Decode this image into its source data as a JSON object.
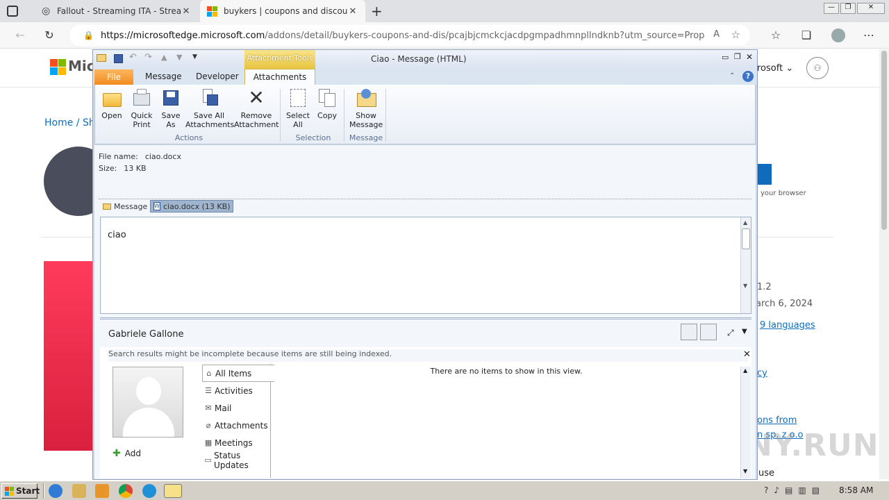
{
  "browser": {
    "tabs": [
      {
        "title": "Fallout - Streaming ITA - Streami",
        "active": false
      },
      {
        "title": "buykers | coupons and discount",
        "active": true
      }
    ],
    "url_domain": "https://microsoftedge.microsoft.com",
    "url_path": "/addons/detail/buykers-coupons-and-dis/pcajbjcmckcjacdpgmpadhmnpllndknb?utm_source=Propeller..."
  },
  "webpage": {
    "brand": "Mic",
    "microsoft_menu": "rosoft",
    "breadcrumb_home": "Home",
    "breadcrumb_sep": " / Sh",
    "browser_note": "your browser",
    "version_frag": "1.2",
    "date_frag": "arch 6, 2024",
    "languages_link": "9 languages",
    "privacy_frag": "cy",
    "options_frag": "ons from",
    "company_frag": "n sp. z o.o",
    "use_frag": "use",
    "watermark": "ANY.RUN"
  },
  "outlook": {
    "title": "Ciao  -  Message (HTML)",
    "contextual_tab": "Attachment Tools",
    "tabs": [
      "File",
      "Message",
      "Developer",
      "Attachments"
    ],
    "ribbon": {
      "open": "Open",
      "quick_print_1": "Quick",
      "quick_print_2": "Print",
      "save_as_1": "Save",
      "save_as_2": "As",
      "save_all_1": "Save All",
      "save_all_2": "Attachments",
      "remove_1": "Remove",
      "remove_2": "Attachment",
      "select_all_1": "Select",
      "select_all_2": "All",
      "copy": "Copy",
      "show_msg_1": "Show",
      "show_msg_2": "Message",
      "groups": [
        "Actions",
        "Selection",
        "Message"
      ]
    },
    "file_name_label": "File name:",
    "file_name_value": "ciao.docx",
    "size_label": "Size:",
    "size_value": "13 KB",
    "message_tab": "Message",
    "attachment_tab": "ciao.docx (13 KB)",
    "body_text": "ciao",
    "people_pane": {
      "name": "Gabriele Gallone",
      "indexing_note": "Search results might be incomplete because items are still being indexed.",
      "add_label": "Add",
      "empty_note": "There are no items to show in this view.",
      "nav": [
        "All Items",
        "Activities",
        "Mail",
        "Attachments",
        "Meetings",
        "Status Updates"
      ]
    }
  },
  "taskbar": {
    "start": "Start",
    "clock": "8:58 AM"
  }
}
